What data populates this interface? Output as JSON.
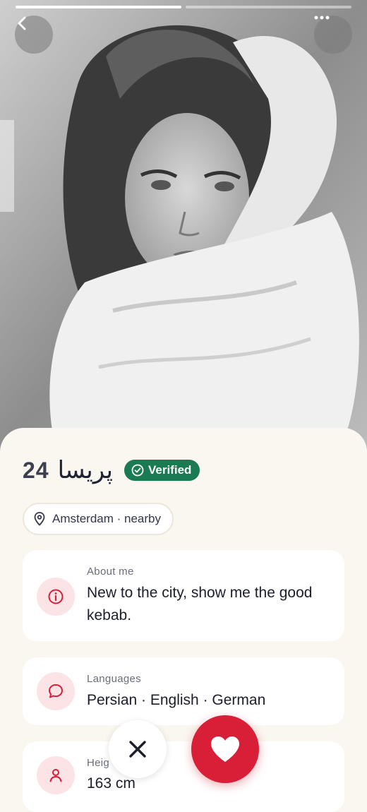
{
  "profile": {
    "age": "24",
    "name": "پریسا",
    "verified_label": "Verified",
    "location": "Amsterdam · nearby"
  },
  "gallery": {
    "photo_count": 2,
    "current_index": 1
  },
  "header": {
    "back_icon": "chevron-left-icon",
    "more_icon": "more-horizontal-icon"
  },
  "about": {
    "label": "About me",
    "value": "New to the city, show me the good kebab."
  },
  "languages": {
    "label": "Languages",
    "value": "Persian · English · German"
  },
  "height": {
    "label": "Heig",
    "value": "163 cm"
  },
  "colors": {
    "accent": "#d91f38",
    "verified": "#1a7a52",
    "icon_bubble": "#fbe3e6"
  }
}
